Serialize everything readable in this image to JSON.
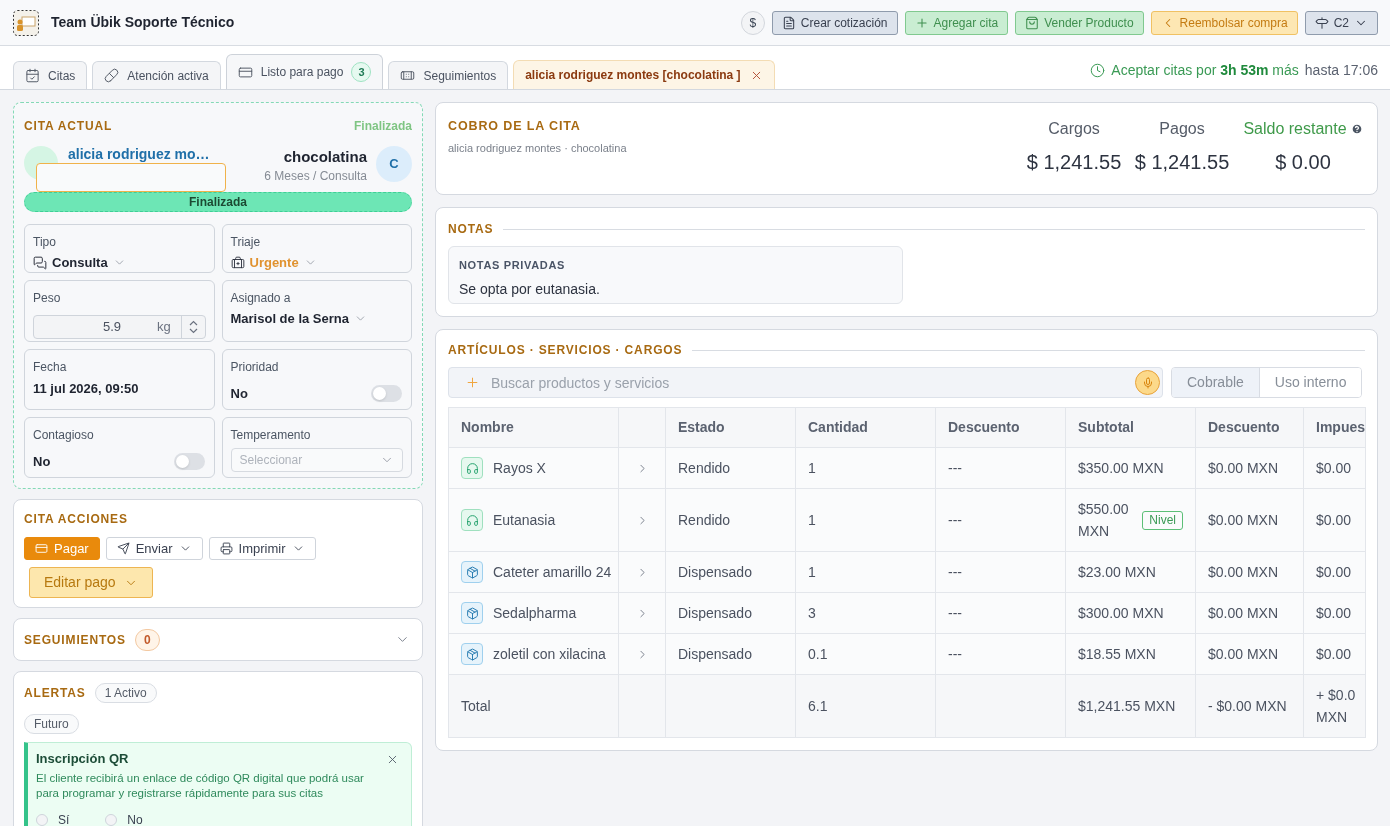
{
  "header": {
    "title": "Team Übik Soporte Técnico",
    "buttons": [
      {
        "label": "$",
        "kind": "circle"
      },
      {
        "label": "Crear cotización",
        "kind": "neutral"
      },
      {
        "label": "Agregar cita",
        "kind": "success"
      },
      {
        "label": "Vender Producto",
        "kind": "success"
      },
      {
        "label": "Reembolsar compra",
        "kind": "warning"
      },
      {
        "label": "C2",
        "kind": "menu"
      }
    ]
  },
  "tabs": [
    {
      "label": "Citas",
      "kind": "section",
      "selected": false
    },
    {
      "label": "Atención activa",
      "kind": "section",
      "selected": false
    },
    {
      "label": "Listo para pago",
      "kind": "section",
      "badge": "3",
      "selected": true
    },
    {
      "label": "Seguimientos",
      "kind": "section",
      "selected": false
    },
    {
      "label": "alicia rodriguez montes [chocolatina ]",
      "kind": "patient",
      "selected": false
    }
  ],
  "schedule": {
    "text": "Aceptar citas por **3h 53m** más",
    "until": "hasta 17:06"
  },
  "current_appointment": {
    "title": "CITA ACTUAL",
    "status": "Finalizada",
    "client": {
      "name": "alicia rodriguez mo…"
    },
    "pet": {
      "name": "chocolatina",
      "details": "6 Meses / Consulta",
      "initial": "C"
    },
    "status_bar": "Finalizada",
    "fields": {
      "tipo": {
        "label": "Tipo",
        "value": "Consulta"
      },
      "triaje": {
        "label": "Triaje",
        "value": "Urgente"
      },
      "peso": {
        "label": "Peso",
        "value": "5.9",
        "unit": "kg"
      },
      "asignado": {
        "label": "Asignado a",
        "value": "Marisol de la Serna"
      },
      "fecha": {
        "label": "Fecha",
        "value": "11 jul 2026, 09:50"
      },
      "prioridad": {
        "label": "Prioridad",
        "value": "No",
        "on": false
      },
      "contagioso": {
        "label": "Contagioso",
        "value": "No",
        "on": false
      },
      "temperamento": {
        "label": "Temperamento",
        "placeholder": "Seleccionar"
      }
    }
  },
  "actions": {
    "title": "CITA ACCIONES",
    "buttons": [
      {
        "label": "Pagar",
        "kind": "primary"
      },
      {
        "label": "Enviar",
        "kind": "menu"
      },
      {
        "label": "Imprimir",
        "kind": "menu"
      }
    ],
    "edit_payment": "Editar pago"
  },
  "followups": {
    "title": "SEGUIMIENTOS",
    "count": "0",
    "expanded": false
  },
  "alerts": {
    "title": "ALERTAS",
    "count": "1 Activo",
    "filter": "Futuro",
    "items": [
      {
        "title": "Inscripción QR",
        "text": "El cliente recibirá un enlace de código QR digital que podrá usar para programar y registrarse rápidamente para sus citas",
        "options": [
          {
            "label": "Sí",
            "selected": false
          },
          {
            "label": "No",
            "selected": false
          }
        ]
      }
    ]
  },
  "billing": {
    "title": "COBRO DE LA CITA",
    "subtitle": "alicia rodriguez montes · chocolatina",
    "totals": [
      {
        "label": "Cargos",
        "value": "$ 1,241.55",
        "kind": "plain"
      },
      {
        "label": "Pagos",
        "value": "$ 1,241.55",
        "kind": "plain"
      },
      {
        "label": "Saldo restante",
        "value": "$ 0.00",
        "kind": "balance"
      }
    ]
  },
  "notes": {
    "title": "NOTAS",
    "private": {
      "title": "NOTAS PRIVADAS",
      "text": "Se opta por eutanasia."
    }
  },
  "items": {
    "title": "ARTÍCULOS · SERVICIOS · CARGOS",
    "search": {
      "placeholder": "Buscar productos y servicios"
    },
    "modes": [
      {
        "label": "Cobrable",
        "selected": true
      },
      {
        "label": "Uso interno",
        "selected": false
      }
    ],
    "columns": [
      "Nombre",
      "Estado",
      "Cantidad",
      "Descuento",
      "Subtotal",
      "Descuento",
      "Impues"
    ],
    "rows": [
      {
        "kind": "service",
        "name": "Rayos X",
        "estado": "Rendido",
        "cantidad": "1",
        "descuento": "---",
        "subtotal": "$350.00 MXN",
        "descuento_2": "$0.00 MXN",
        "column_8": "$0.00"
      },
      {
        "kind": "service",
        "name": "Eutanasia",
        "estado": "Rendido",
        "cantidad": "1",
        "descuento": "---",
        "subtotal": "$550.00 MXN",
        "badge": "Nivel",
        "descuento_2": "$0.00 MXN",
        "column_8": "$0.00"
      },
      {
        "kind": "product",
        "name": "Cateter amarillo 24",
        "estado": "Dispensado",
        "cantidad": "1",
        "descuento": "---",
        "subtotal": "$23.00 MXN",
        "descuento_2": "$0.00 MXN",
        "column_8": "$0.00"
      },
      {
        "kind": "product",
        "name": "Sedalpharma",
        "estado": "Dispensado",
        "cantidad": "3",
        "descuento": "---",
        "subtotal": "$300.00 MXN",
        "descuento_2": "$0.00 MXN",
        "column_8": "$0.00"
      },
      {
        "kind": "product",
        "name": "zoletil con xilacina",
        "estado": "Dispensado",
        "cantidad": "0.1",
        "descuento": "---",
        "subtotal": "$18.55 MXN",
        "descuento_2": "$0.00 MXN",
        "column_8": "$0.00"
      }
    ],
    "total": {
      "label": "Total",
      "cantidad": "6.1",
      "subtotal": "$1,241.55 MXN",
      "descuento_2": "- $0.00 MXN",
      "column_8": "+ $0.0 MXN"
    }
  }
}
